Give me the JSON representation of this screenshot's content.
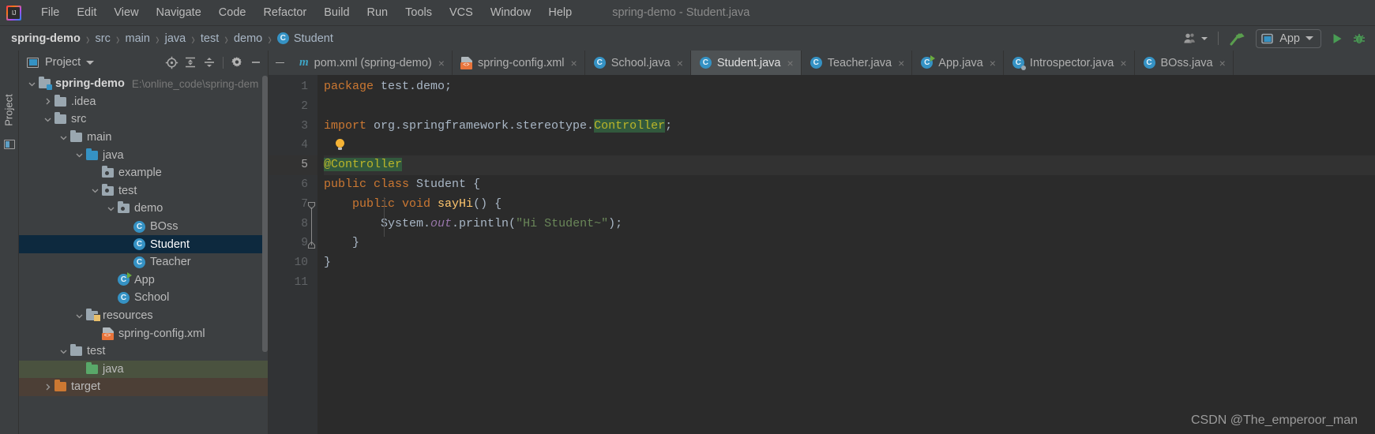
{
  "window": {
    "title": "spring-demo - Student.java"
  },
  "menubar": {
    "logo": "intellij-idea-logo",
    "items": [
      {
        "label": "File",
        "mnemonic": "F"
      },
      {
        "label": "Edit",
        "mnemonic": "E"
      },
      {
        "label": "View",
        "mnemonic": "V"
      },
      {
        "label": "Navigate",
        "mnemonic": "N"
      },
      {
        "label": "Code",
        "mnemonic": "C"
      },
      {
        "label": "Refactor",
        "mnemonic": "R"
      },
      {
        "label": "Build",
        "mnemonic": "B"
      },
      {
        "label": "Run",
        "mnemonic": "R"
      },
      {
        "label": "Tools",
        "mnemonic": "T"
      },
      {
        "label": "VCS",
        "mnemonic": "S"
      },
      {
        "label": "Window",
        "mnemonic": "W"
      },
      {
        "label": "Help",
        "mnemonic": "H"
      }
    ]
  },
  "breadcrumb": {
    "separator": "›",
    "items": [
      {
        "label": "spring-demo",
        "icon": null
      },
      {
        "label": "src",
        "icon": null
      },
      {
        "label": "main",
        "icon": null
      },
      {
        "label": "java",
        "icon": null
      },
      {
        "label": "test",
        "icon": null
      },
      {
        "label": "demo",
        "icon": null
      },
      {
        "label": "Student",
        "icon": "class-icon"
      }
    ]
  },
  "toolbar": {
    "user_icon": "user-accounts-icon",
    "build_icon": "build-hammer-icon",
    "run_config": {
      "label": "App",
      "icon": "run-configuration-icon"
    },
    "run_icon": "run-play-icon",
    "debug_icon": "debug-bug-icon",
    "accent_green": "#499c54",
    "hammer_green": "#5a9e4e"
  },
  "project_panel": {
    "vertical_tab": "Project",
    "header": {
      "title": "Project",
      "icon": "project-view-icon",
      "tools": [
        {
          "name": "locate-icon"
        },
        {
          "name": "expand-all-icon"
        },
        {
          "name": "collapse-all-icon"
        },
        {
          "name": "settings-gear-icon"
        },
        {
          "name": "hide-icon"
        }
      ]
    },
    "tree": [
      {
        "label": "spring-demo",
        "path": "E:\\online_code\\spring-dem",
        "indent": 0,
        "twisty": "down",
        "icon": "module-folder",
        "bold": true,
        "state": ""
      },
      {
        "label": ".idea",
        "path": "",
        "indent": 1,
        "twisty": "right",
        "icon": "folder",
        "bold": false,
        "state": ""
      },
      {
        "label": "src",
        "path": "",
        "indent": 1,
        "twisty": "down",
        "icon": "folder",
        "bold": false,
        "state": ""
      },
      {
        "label": "main",
        "path": "",
        "indent": 2,
        "twisty": "down",
        "icon": "folder",
        "bold": false,
        "state": ""
      },
      {
        "label": "java",
        "path": "",
        "indent": 3,
        "twisty": "down",
        "icon": "source-folder",
        "bold": false,
        "state": ""
      },
      {
        "label": "example",
        "path": "",
        "indent": 4,
        "twisty": "none",
        "icon": "package-folder",
        "bold": false,
        "state": ""
      },
      {
        "label": "test",
        "path": "",
        "indent": 4,
        "twisty": "down",
        "icon": "package-folder",
        "bold": false,
        "state": ""
      },
      {
        "label": "demo",
        "path": "",
        "indent": 5,
        "twisty": "down",
        "icon": "package-folder",
        "bold": false,
        "state": ""
      },
      {
        "label": "BOss",
        "path": "",
        "indent": 6,
        "twisty": "none",
        "icon": "class-icon",
        "bold": false,
        "state": ""
      },
      {
        "label": "Student",
        "path": "",
        "indent": 6,
        "twisty": "none",
        "icon": "class-icon",
        "bold": false,
        "state": "selected"
      },
      {
        "label": "Teacher",
        "path": "",
        "indent": 6,
        "twisty": "none",
        "icon": "class-icon",
        "bold": false,
        "state": ""
      },
      {
        "label": "App",
        "path": "",
        "indent": 5,
        "twisty": "none",
        "icon": "class-runnable-icon",
        "bold": false,
        "state": ""
      },
      {
        "label": "School",
        "path": "",
        "indent": 5,
        "twisty": "none",
        "icon": "class-icon",
        "bold": false,
        "state": ""
      },
      {
        "label": "resources",
        "path": "",
        "indent": 3,
        "twisty": "down",
        "icon": "resource-folder",
        "bold": false,
        "state": ""
      },
      {
        "label": "spring-config.xml",
        "path": "",
        "indent": 4,
        "twisty": "none",
        "icon": "xml-file-icon",
        "bold": false,
        "state": ""
      },
      {
        "label": "test",
        "path": "",
        "indent": 2,
        "twisty": "down",
        "icon": "folder",
        "bold": false,
        "state": ""
      },
      {
        "label": "java",
        "path": "",
        "indent": 3,
        "twisty": "none",
        "icon": "test-source-folder",
        "bold": false,
        "state": "test-source"
      },
      {
        "label": "target",
        "path": "",
        "indent": 1,
        "twisty": "right",
        "icon": "excluded-folder",
        "bold": false,
        "state": "excluded"
      }
    ]
  },
  "editor_tabs": {
    "minimize_icon": "minimize-icon",
    "close_icon": "×",
    "tabs": [
      {
        "label": "pom.xml (spring-demo)",
        "icon": "maven-icon",
        "active": false
      },
      {
        "label": "spring-config.xml",
        "icon": "xml-file-icon",
        "active": false
      },
      {
        "label": "School.java",
        "icon": "class-icon",
        "active": false
      },
      {
        "label": "Student.java",
        "icon": "class-icon",
        "active": true
      },
      {
        "label": "Teacher.java",
        "icon": "class-icon",
        "active": false
      },
      {
        "label": "App.java",
        "icon": "class-runnable-icon",
        "active": false
      },
      {
        "label": "Introspector.java",
        "icon": "class-bean-icon",
        "active": false
      },
      {
        "label": "BOss.java",
        "icon": "class-icon",
        "active": false
      }
    ]
  },
  "editor": {
    "line_numbers": [
      "1",
      "2",
      "3",
      "4",
      "5",
      "6",
      "7",
      "8",
      "9",
      "10",
      "11"
    ],
    "current_line": 5,
    "lines": [
      {
        "n": 1,
        "segments": [
          {
            "t": "package",
            "c": "kw"
          },
          {
            "t": " test.demo;",
            "c": "plain"
          }
        ]
      },
      {
        "n": 2,
        "segments": []
      },
      {
        "n": 3,
        "segments": [
          {
            "t": "import",
            "c": "kw"
          },
          {
            "t": " org.springframework.stereotype.",
            "c": "plain"
          },
          {
            "t": "Controller",
            "c": "hl"
          },
          {
            "t": ";",
            "c": "plain"
          }
        ]
      },
      {
        "n": 4,
        "segments": [
          {
            "t": "",
            "c": "bulb"
          }
        ]
      },
      {
        "n": 5,
        "segments": [
          {
            "t": "@Controller",
            "c": "hl"
          }
        ]
      },
      {
        "n": 6,
        "segments": [
          {
            "t": "public class",
            "c": "kw"
          },
          {
            "t": " Student {",
            "c": "plain"
          }
        ]
      },
      {
        "n": 7,
        "segments": [
          {
            "t": "    public void",
            "c": "kw"
          },
          {
            "t": " ",
            "c": "plain"
          },
          {
            "t": "sayHi",
            "c": "mth"
          },
          {
            "t": "() {",
            "c": "plain"
          }
        ]
      },
      {
        "n": 8,
        "segments": [
          {
            "t": "        System.",
            "c": "plain"
          },
          {
            "t": "out",
            "c": "fld"
          },
          {
            "t": ".println(",
            "c": "plain"
          },
          {
            "t": "\"Hi Student~\"",
            "c": "str"
          },
          {
            "t": ");",
            "c": "plain"
          }
        ]
      },
      {
        "n": 9,
        "segments": [
          {
            "t": "    }",
            "c": "plain"
          }
        ]
      },
      {
        "n": 10,
        "segments": [
          {
            "t": "}",
            "c": "plain"
          }
        ]
      },
      {
        "n": 11,
        "segments": []
      }
    ]
  },
  "watermark": {
    "text": "CSDN @The_emperoor_man"
  },
  "colors": {
    "background": "#3c3f41",
    "editor_bg": "#2b2b2b",
    "gutter_bg": "#313335",
    "selection": "#0d293e",
    "keyword": "#cc7832",
    "string": "#6a8759",
    "annotation": "#bbb529",
    "method": "#ffc66d",
    "field": "#9876aa",
    "text": "#a9b7c6"
  }
}
